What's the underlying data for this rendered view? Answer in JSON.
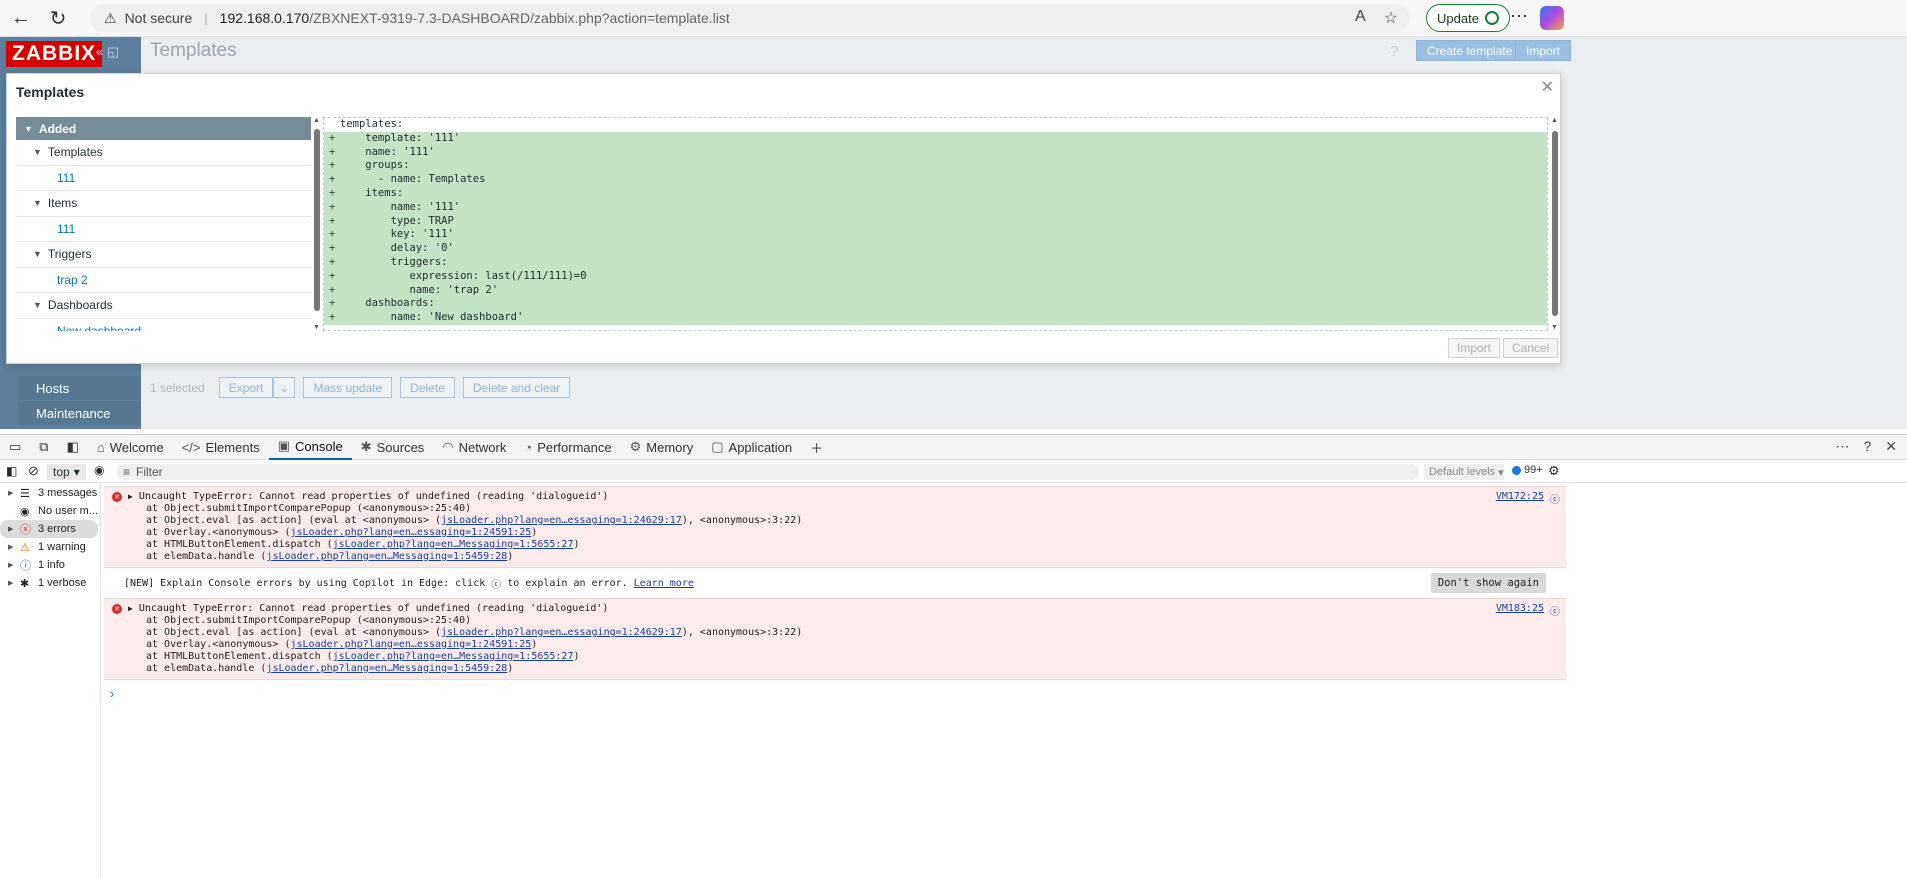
{
  "browser": {
    "warning_text": "Not secure",
    "url_host": "192.168.0.170",
    "url_path": "/ZBXNEXT-9319-7.3-DASHBOARD/zabbix.php?action=template.list",
    "update_label": "Update"
  },
  "app": {
    "logo": "ZABBIX",
    "page_title": "Templates",
    "create_template": "Create template",
    "import": "Import",
    "help": "?",
    "sidebar_items": [
      "Hosts",
      "Maintenance"
    ],
    "selected_text": "1 selected",
    "buttons": [
      "Export",
      "Mass update",
      "Delete",
      "Delete and clear"
    ]
  },
  "modal": {
    "title": "Templates",
    "tree_header": "Added",
    "tree": [
      {
        "section": "Templates",
        "items": [
          "111"
        ]
      },
      {
        "section": "Items",
        "items": [
          "111"
        ]
      },
      {
        "section": "Triggers",
        "items": [
          "trap 2"
        ]
      },
      {
        "section": "Dashboards",
        "items": [
          "New dashboard"
        ]
      }
    ],
    "code_lines": [
      {
        "mark": "",
        "text": "templates:",
        "added": false
      },
      {
        "mark": "+",
        "text": "    template: '111'",
        "added": true
      },
      {
        "mark": "+",
        "text": "    name: '111'",
        "added": true
      },
      {
        "mark": "+",
        "text": "    groups:",
        "added": true
      },
      {
        "mark": "+",
        "text": "      - name: Templates",
        "added": true
      },
      {
        "mark": "+",
        "text": "    items:",
        "added": true
      },
      {
        "mark": "+",
        "text": "        name: '111'",
        "added": true
      },
      {
        "mark": "+",
        "text": "        type: TRAP",
        "added": true
      },
      {
        "mark": "+",
        "text": "        key: '111'",
        "added": true
      },
      {
        "mark": "+",
        "text": "        delay: '0'",
        "added": true
      },
      {
        "mark": "+",
        "text": "        triggers:",
        "added": true
      },
      {
        "mark": "+",
        "text": "           expression: last(/111/111)=0",
        "added": true
      },
      {
        "mark": "+",
        "text": "           name: 'trap 2'",
        "added": true
      },
      {
        "mark": "+",
        "text": "    dashboards:",
        "added": true
      },
      {
        "mark": "+",
        "text": "        name: 'New dashboard'",
        "added": true
      }
    ],
    "import_label": "Import",
    "cancel_label": "Cancel"
  },
  "devtools": {
    "tabs": [
      {
        "label": "Welcome",
        "icon": "home-icon"
      },
      {
        "label": "Elements",
        "icon": "code-icon"
      },
      {
        "label": "Console",
        "icon": "console-icon",
        "active": true
      },
      {
        "label": "Sources",
        "icon": "bug-icon"
      },
      {
        "label": "Network",
        "icon": "wifi-icon"
      },
      {
        "label": "Performance",
        "icon": "gauge-icon"
      },
      {
        "label": "Memory",
        "icon": "chip-icon"
      },
      {
        "label": "Application",
        "icon": "app-icon"
      }
    ],
    "context": "top",
    "filter_placeholder": "Filter",
    "levels": "Default levels",
    "issues_count": "99+",
    "sidebar": [
      {
        "label": "3 messages",
        "icon": "list-icon",
        "arrow": true
      },
      {
        "label": "No user m...",
        "icon": "user-icon",
        "arrow": false
      },
      {
        "label": "3 errors",
        "icon": "error-icon",
        "arrow": true,
        "selected": true
      },
      {
        "label": "1 warning",
        "icon": "warning-icon",
        "arrow": true
      },
      {
        "label": "1 info",
        "icon": "info-icon",
        "arrow": true
      },
      {
        "label": "1 verbose",
        "icon": "bug-icon",
        "arrow": true
      }
    ],
    "errors": [
      {
        "message": "Uncaught TypeError: Cannot read properties of undefined (reading 'dialogueid')",
        "source": "VM172:25",
        "stack": [
          {
            "pre": "at Object.submitImportComparePopup (<anonymous>:25:40)",
            "link": "",
            "post": ""
          },
          {
            "pre": "at Object.eval [as action] (eval at <anonymous> (",
            "link": "jsLoader.php?lang=en…essaging=1:24629:17",
            "post": "), <anonymous>:3:22)"
          },
          {
            "pre": "at Overlay.<anonymous> (",
            "link": "jsLoader.php?lang=en…essaging=1:24591:25",
            "post": ")"
          },
          {
            "pre": "at HTMLButtonElement.dispatch (",
            "link": "jsLoader.php?lang=en…Messaging=1:5655:27",
            "post": ")"
          },
          {
            "pre": "at elemData.handle (",
            "link": "jsLoader.php?lang=en…Messaging=1:5459:28",
            "post": ")"
          }
        ]
      },
      {
        "message": "Uncaught TypeError: Cannot read properties of undefined (reading 'dialogueid')",
        "source": "VM183:25",
        "stack": [
          {
            "pre": "at Object.submitImportComparePopup (<anonymous>:25:40)",
            "link": "",
            "post": ""
          },
          {
            "pre": "at Object.eval [as action] (eval at <anonymous> (",
            "link": "jsLoader.php?lang=en…essaging=1:24629:17",
            "post": "), <anonymous>:3:22)"
          },
          {
            "pre": "at Overlay.<anonymous> (",
            "link": "jsLoader.php?lang=en…essaging=1:24591:25",
            "post": ")"
          },
          {
            "pre": "at HTMLButtonElement.dispatch (",
            "link": "jsLoader.php?lang=en…Messaging=1:5655:27",
            "post": ")"
          },
          {
            "pre": "at elemData.handle (",
            "link": "jsLoader.php?lang=en…Messaging=1:5459:28",
            "post": ")"
          }
        ]
      }
    ],
    "copilot_pre": "[NEW] Explain Console errors by using Copilot in Edge: click",
    "copilot_post": "to explain an error.",
    "learn_more": "Learn more",
    "dont_show": "Don't show again"
  }
}
